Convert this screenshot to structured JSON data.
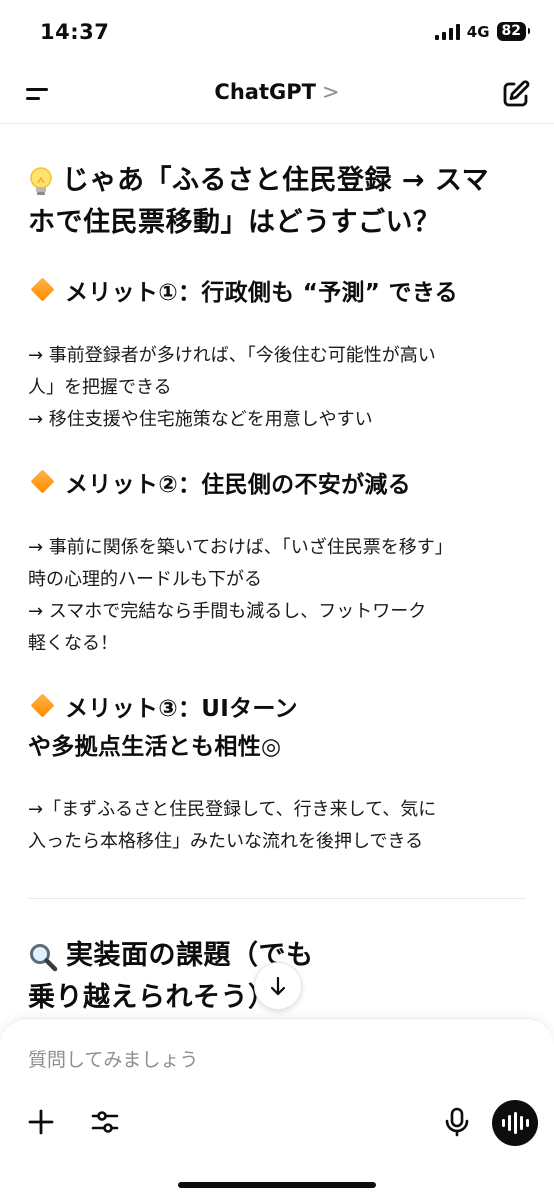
{
  "status": {
    "time": "14:37",
    "network": "4G",
    "battery": "82"
  },
  "header": {
    "title": "ChatGPT",
    "chevron": ">"
  },
  "message": {
    "heading_main": [
      "じゃあ「ふるさと住民登録 → スマ",
      "ホで住民票移動」はどうすごい？"
    ],
    "merit1": {
      "title": "メリット①：行政側も “予測” できる",
      "lines": [
        "→ 事前登録者が多ければ、「今後住む可能性が高い",
        "人」を把握できる",
        "→ 移住支援や住宅施策などを用意しやすい"
      ]
    },
    "merit2": {
      "title": "メリット②：住民側の不安が減る",
      "lines": [
        "→ 事前に関係を築いておけば、「いざ住民票を移す」",
        "時の心理的ハードルも下がる",
        "→ スマホで完結なら手間も減るし、フットワーク",
        "軽くなる！"
      ]
    },
    "merit3": {
      "title": [
        "メリット③：UIターン",
        "や多拠点生活とも相性◎"
      ],
      "lines": [
        "→「まずふるさと住民登録して、行き来して、気に",
        "入ったら本格移住」みたいな流れを後押しできる"
      ]
    },
    "heading_issues": [
      "実装面の課題（でも",
      "乗り越えられそう）"
    ]
  },
  "composer": {
    "placeholder": "質問してみましょう"
  },
  "colors": {
    "accent_orange": "#ff8c00",
    "text": "#0d0d0d"
  }
}
